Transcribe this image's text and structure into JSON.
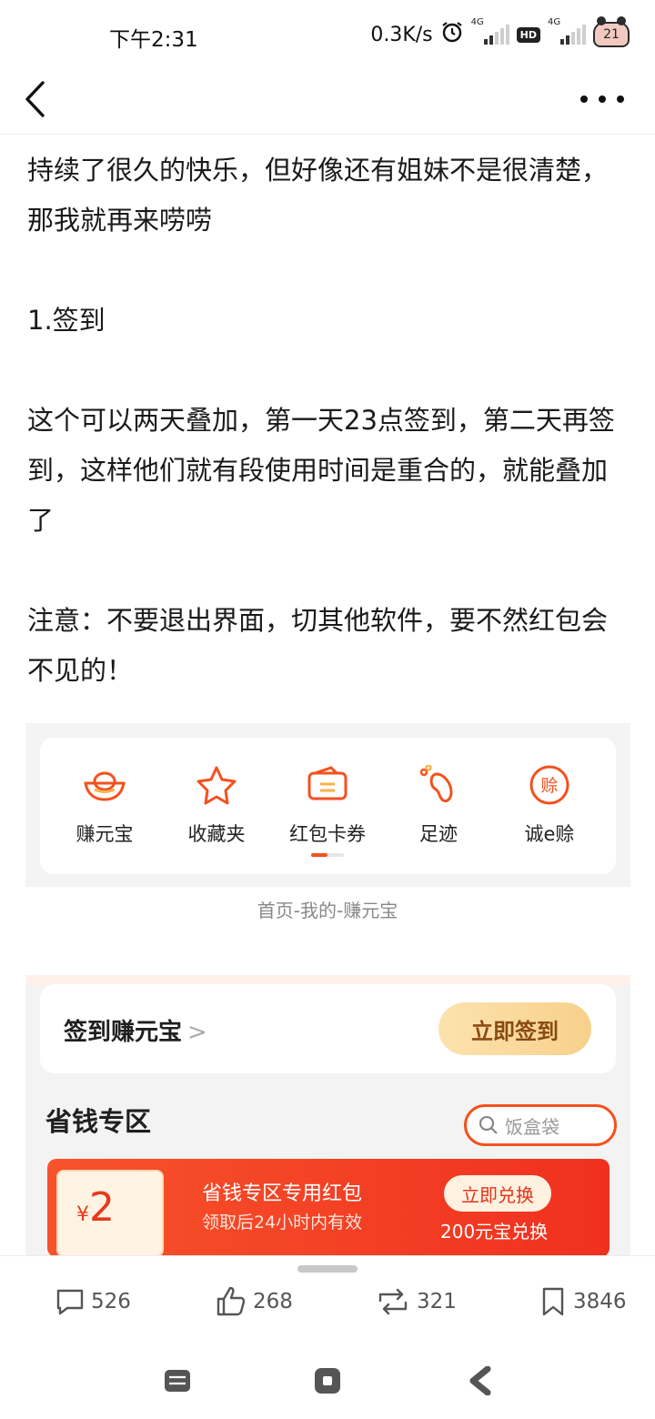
{
  "status_bar": {
    "time": "下午2:31",
    "net_speed": "0.3K/s",
    "signal_label_1": "4G",
    "hd_label": "HD",
    "signal_label_2": "4G",
    "battery": "21"
  },
  "article": {
    "paragraphs": [
      "持续了很久的快乐，但好像还有姐妹不是很清楚，那我就再来唠唠",
      "1.签到",
      "这个可以两天叠加，第一天23点签到，第二天再签到，这样他们就有段使用时间是重合的，就能叠加了",
      "注意：不要退出界面，切其他软件，要不然红包会不见的！"
    ]
  },
  "image1": {
    "items": [
      {
        "label": "赚元宝",
        "icon": "gold-ingot-icon"
      },
      {
        "label": "收藏夹",
        "icon": "star-icon"
      },
      {
        "label": "红包卡券",
        "icon": "coupon-icon"
      },
      {
        "label": "足迹",
        "icon": "footprint-icon"
      },
      {
        "label": "诚e赊",
        "icon": "credit-icon"
      }
    ],
    "credit_icon_char": "赊",
    "caption": "首页-我的-赚元宝"
  },
  "image2": {
    "checkin_title": "签到赚元宝",
    "checkin_chevron": ">",
    "checkin_button": "立即签到",
    "zone_title": "省钱专区",
    "search_placeholder": "饭盒袋",
    "coupon": {
      "currency": "¥",
      "amount": "2",
      "name": "省钱专区专用红包",
      "desc": "领取后24小时内有效",
      "button": "立即兑换",
      "cost": "200元宝兑换"
    }
  },
  "actions": {
    "comments": "526",
    "likes": "268",
    "reposts": "321",
    "bookmarks": "3846"
  },
  "colors": {
    "accent": "#f4511e",
    "coupon_red": "#f0301f",
    "gold": "#f8d08c"
  }
}
